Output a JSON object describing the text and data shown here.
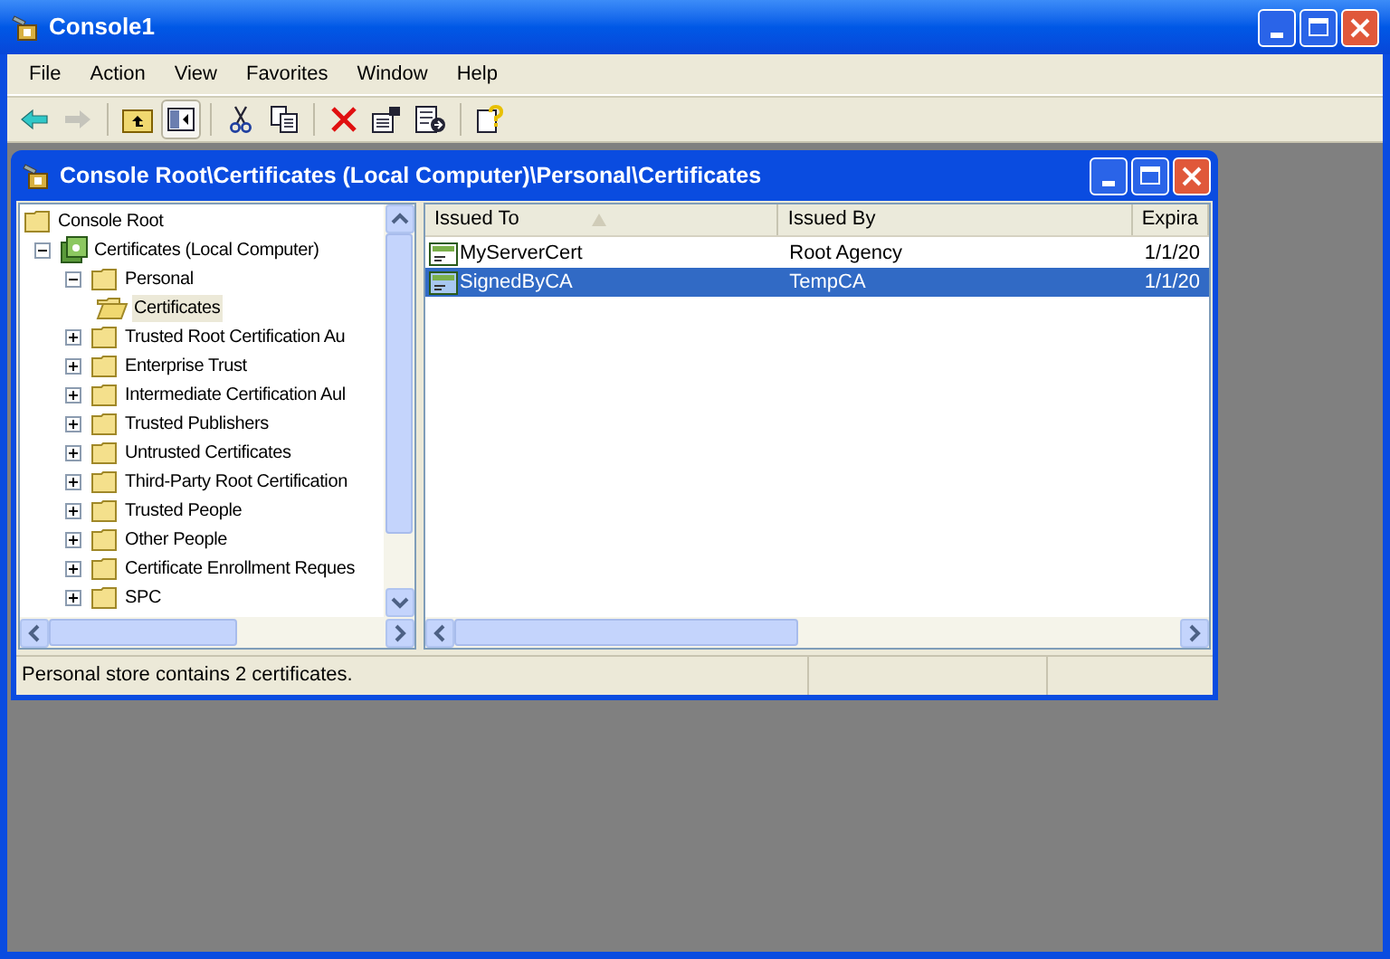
{
  "window": {
    "title": "Console1"
  },
  "menu": [
    "File",
    "Action",
    "View",
    "Favorites",
    "Window",
    "Help"
  ],
  "toolbar": [
    {
      "kind": "back",
      "disabled": false,
      "pressed": false
    },
    {
      "kind": "forward",
      "disabled": true,
      "pressed": false
    },
    {
      "kind": "sep"
    },
    {
      "kind": "up",
      "disabled": false,
      "pressed": false
    },
    {
      "kind": "tree",
      "disabled": false,
      "pressed": true
    },
    {
      "kind": "sep"
    },
    {
      "kind": "cut",
      "disabled": false,
      "pressed": false
    },
    {
      "kind": "copy",
      "disabled": false,
      "pressed": false
    },
    {
      "kind": "sep"
    },
    {
      "kind": "delete",
      "disabled": false,
      "pressed": false
    },
    {
      "kind": "properties",
      "disabled": false,
      "pressed": false
    },
    {
      "kind": "export",
      "disabled": false,
      "pressed": false
    },
    {
      "kind": "sep"
    },
    {
      "kind": "help",
      "disabled": false,
      "pressed": false
    }
  ],
  "child_window": {
    "title": "Console Root\\Certificates (Local Computer)\\Personal\\Certificates"
  },
  "tree": [
    {
      "label": "Console Root",
      "kind": "folder",
      "selected": false,
      "children": [
        {
          "label": "Certificates (Local Computer)",
          "kind": "snapin",
          "expanded": true,
          "selected": false,
          "children": [
            {
              "label": "Personal",
              "kind": "folder",
              "expanded": true,
              "selected": false,
              "children": [
                {
                  "label": "Certificates",
                  "kind": "open-folder",
                  "selected": true
                }
              ]
            },
            {
              "label": "Trusted Root Certification Au",
              "kind": "folder",
              "expanded": false,
              "selected": false
            },
            {
              "label": "Enterprise Trust",
              "kind": "folder",
              "expanded": false,
              "selected": false
            },
            {
              "label": "Intermediate Certification Aul",
              "kind": "folder",
              "expanded": false,
              "selected": false
            },
            {
              "label": "Trusted Publishers",
              "kind": "folder",
              "expanded": false,
              "selected": false
            },
            {
              "label": "Untrusted Certificates",
              "kind": "folder",
              "expanded": false,
              "selected": false
            },
            {
              "label": "Third-Party Root Certification",
              "kind": "folder",
              "expanded": false,
              "selected": false
            },
            {
              "label": "Trusted People",
              "kind": "folder",
              "expanded": false,
              "selected": false
            },
            {
              "label": "Other People",
              "kind": "folder",
              "expanded": false,
              "selected": false
            },
            {
              "label": "Certificate Enrollment Reques",
              "kind": "folder",
              "expanded": false,
              "selected": false
            },
            {
              "label": "SPC",
              "kind": "folder",
              "expanded": false,
              "selected": false
            }
          ]
        }
      ]
    }
  ],
  "table": {
    "columns": [
      {
        "label": "Issued To",
        "sorted": true
      },
      {
        "label": "Issued By",
        "sorted": false
      },
      {
        "label": "Expira",
        "sorted": false
      }
    ],
    "rows": [
      {
        "cells": [
          "MyServerCert",
          "Root Agency",
          "1/1/20"
        ],
        "selected": false
      },
      {
        "cells": [
          "SignedByCA",
          "TempCA",
          "1/1/20"
        ],
        "selected": true
      }
    ]
  },
  "status_bar": {
    "text": "Personal store contains 2 certificates."
  }
}
